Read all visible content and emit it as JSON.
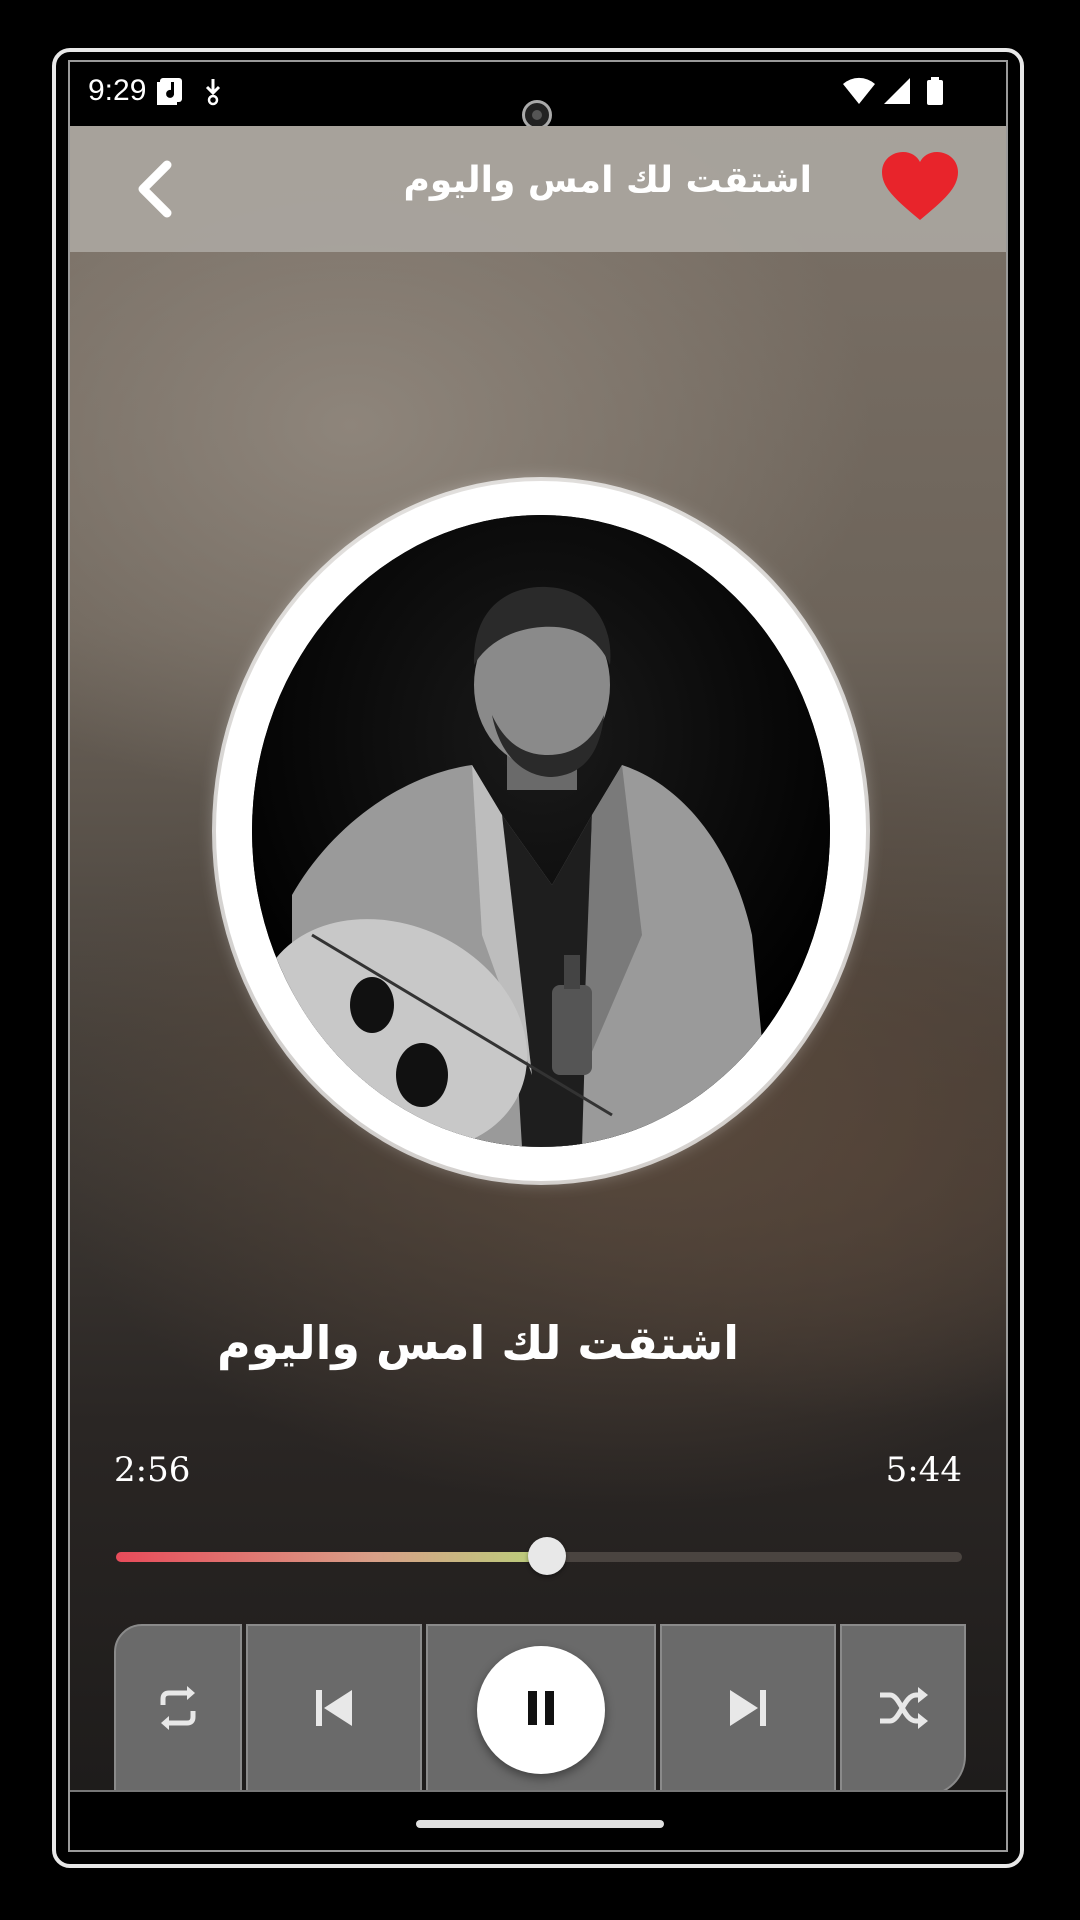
{
  "status_bar": {
    "time": "9:29",
    "icons": [
      "music-note-icon",
      "download-icon",
      "wifi-icon",
      "signal-icon",
      "battery-icon"
    ]
  },
  "header": {
    "title": "اشتقت لك امس واليوم",
    "back_icon": "chevron-left-icon",
    "favorite_icon": "heart-icon",
    "favorite_color": "#e8242b"
  },
  "player": {
    "song_title": "اشتقت لك امس واليوم",
    "current_time": "2:56",
    "total_time": "5:44",
    "progress_percent": 51,
    "progress_colors": [
      "#e84b5a",
      "#b9cf7a"
    ]
  },
  "controls": [
    "repeat-icon",
    "previous-icon",
    "pause-icon",
    "next-icon",
    "shuffle-icon"
  ]
}
